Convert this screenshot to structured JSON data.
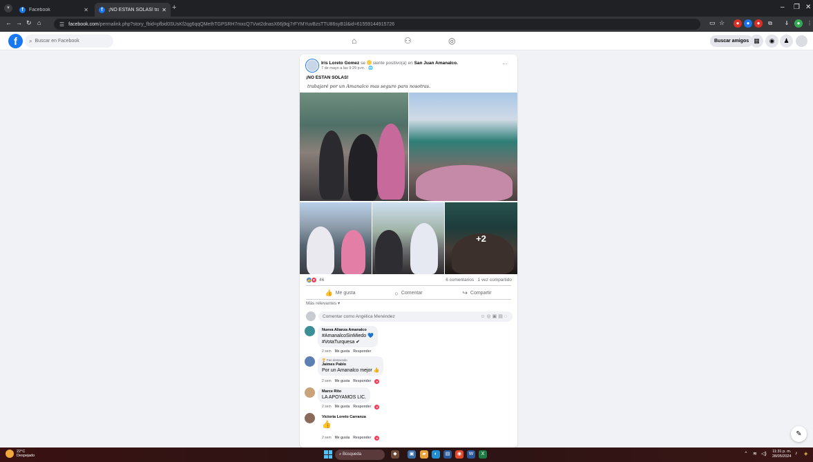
{
  "browser": {
    "tabs": [
      {
        "label": "Facebook",
        "active": false
      },
      {
        "label": "¡NO ESTAN SOLAS! trabajaré p",
        "active": true
      }
    ],
    "url_host": "facebook.com",
    "url_path": "/permalink.php?story_fbid=pfbid0SUsKf2qg6qqQMethTGPSRH7mxcQ7Vwt2dnasX66j9qj7rFYMYuvBzsTTU86syB1l&id=61559144915726",
    "nav_icons": [
      "back-icon",
      "forward-icon",
      "reload-icon",
      "home-icon"
    ],
    "colors": {
      "tabstrip": "#202124",
      "toolbar": "#35363a"
    }
  },
  "fb": {
    "logo": "f",
    "search_placeholder": "Buscar en Facebook",
    "nav": [
      "home-icon",
      "friends-icon",
      "groups-icon"
    ],
    "find_friends": "Buscar amigos",
    "colors": {
      "brand": "#1877f2",
      "page_bg": "#f0f2f5"
    }
  },
  "post": {
    "author": "Iris Loreto Gomez",
    "feeling_pre": "se",
    "feeling": "siente positivo(a) en",
    "location": "San Juan Amanalco.",
    "time": "7 de mayo a las 9:29 p.m. · 🌐",
    "more": "···",
    "title": "¡NO ESTAN SOLAS!",
    "body": "trabajaré por un Amanalco mas seguro para nosotras.",
    "extra_photos": "+2",
    "reaction_count": "46",
    "comments_count": "6 comentarios",
    "shares_count": "1 vez compartido",
    "actions": {
      "like": "Me gusta",
      "comment": "Comentar",
      "share": "Compartir"
    },
    "relevance": "Más relevantes ▾",
    "comment_placeholder": "Comentar como Angélica Menéndez"
  },
  "comments": [
    {
      "name": "Nueva Alianza Amanalco",
      "badge": "",
      "lines": [
        "#AmanalcoSinMiedo 💙",
        "#VotaTurquesa ✔"
      ],
      "time": "2 sem",
      "like": "Me gusta",
      "reply": "Responder",
      "reacted": false
    },
    {
      "name": "Jaimes Pablo",
      "badge": "🏆 Fan destacado",
      "lines": [
        "Por un Amanalco mejor 👍"
      ],
      "time": "2 sem",
      "like": "Me gusta",
      "reply": "Responder",
      "reacted": true
    },
    {
      "name": "Marce Rito",
      "badge": "",
      "lines": [
        "LA APOYAMOS LIC."
      ],
      "time": "2 sem",
      "like": "Me gusta",
      "reply": "Responder",
      "reacted": true
    },
    {
      "name": "Victoria Loreto Carranza",
      "badge": "",
      "lines": [
        "👍"
      ],
      "time": "2 sem",
      "like": "Me gusta",
      "reply": "Responder",
      "reacted": true
    }
  ],
  "taskbar": {
    "temp": "22°C",
    "weather": "Despejado",
    "search": "Búsqueda",
    "time": "11:31 p. m.",
    "date": "28/05/2024"
  }
}
